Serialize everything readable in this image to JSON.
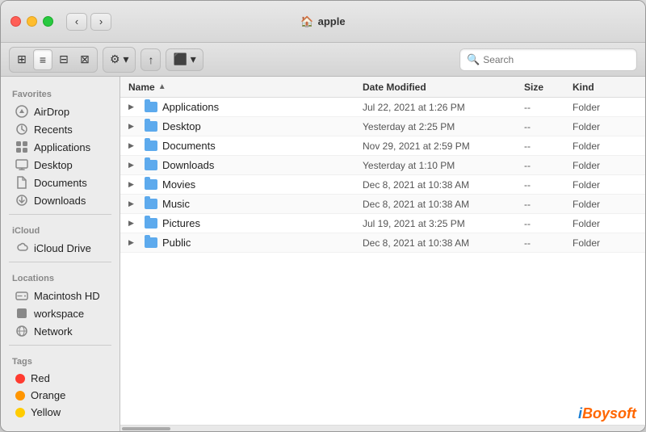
{
  "window": {
    "title": "apple",
    "home_icon": "🏠"
  },
  "toolbar": {
    "search_placeholder": "Search",
    "view_buttons": [
      {
        "label": "⊞",
        "id": "icon-view"
      },
      {
        "label": "≡",
        "id": "list-view",
        "active": true
      },
      {
        "label": "⊟",
        "id": "column-view"
      },
      {
        "label": "⊠",
        "id": "gallery-view"
      }
    ],
    "arrange_label": "⚙",
    "share_label": "↑",
    "action_label": "•••",
    "quick_look_label": "⬛"
  },
  "sidebar": {
    "sections": [
      {
        "label": "Favorites",
        "items": [
          {
            "name": "AirDrop",
            "icon": "📡",
            "type": "airdrop"
          },
          {
            "name": "Recents",
            "icon": "🕐",
            "type": "recents"
          },
          {
            "name": "Applications",
            "icon": "📱",
            "type": "applications"
          },
          {
            "name": "Desktop",
            "icon": "🖥",
            "type": "desktop"
          },
          {
            "name": "Documents",
            "icon": "📄",
            "type": "documents"
          },
          {
            "name": "Downloads",
            "icon": "⬇",
            "type": "downloads"
          }
        ]
      },
      {
        "label": "iCloud",
        "items": [
          {
            "name": "iCloud Drive",
            "icon": "☁",
            "type": "icloud"
          }
        ]
      },
      {
        "label": "Locations",
        "items": [
          {
            "name": "Macintosh HD",
            "icon": "💾",
            "type": "hd"
          },
          {
            "name": "workspace",
            "icon": "⬛",
            "type": "workspace"
          },
          {
            "name": "Network",
            "icon": "🌐",
            "type": "network"
          }
        ]
      },
      {
        "label": "Tags",
        "items": [
          {
            "name": "Red",
            "color": "#ff3b30",
            "type": "tag"
          },
          {
            "name": "Orange",
            "color": "#ff9500",
            "type": "tag"
          },
          {
            "name": "Yellow",
            "color": "#ffcc00",
            "type": "tag"
          }
        ]
      }
    ]
  },
  "file_list": {
    "columns": {
      "name": "Name",
      "date_modified": "Date Modified",
      "size": "Size",
      "kind": "Kind"
    },
    "files": [
      {
        "name": "Applications",
        "date": "Jul 22, 2021 at 1:26 PM",
        "size": "--",
        "kind": "Folder"
      },
      {
        "name": "Desktop",
        "date": "Yesterday at 2:25 PM",
        "size": "--",
        "kind": "Folder"
      },
      {
        "name": "Documents",
        "date": "Nov 29, 2021 at 2:59 PM",
        "size": "--",
        "kind": "Folder"
      },
      {
        "name": "Downloads",
        "date": "Yesterday at 1:10 PM",
        "size": "--",
        "kind": "Folder"
      },
      {
        "name": "Movies",
        "date": "Dec 8, 2021 at 10:38 AM",
        "size": "--",
        "kind": "Folder"
      },
      {
        "name": "Music",
        "date": "Dec 8, 2021 at 10:38 AM",
        "size": "--",
        "kind": "Folder"
      },
      {
        "name": "Pictures",
        "date": "Jul 19, 2021 at 3:25 PM",
        "size": "--",
        "kind": "Folder"
      },
      {
        "name": "Public",
        "date": "Dec 8, 2021 at 10:38 AM",
        "size": "--",
        "kind": "Folder"
      }
    ]
  },
  "watermark": {
    "prefix": "i",
    "name": "Boysoft"
  }
}
